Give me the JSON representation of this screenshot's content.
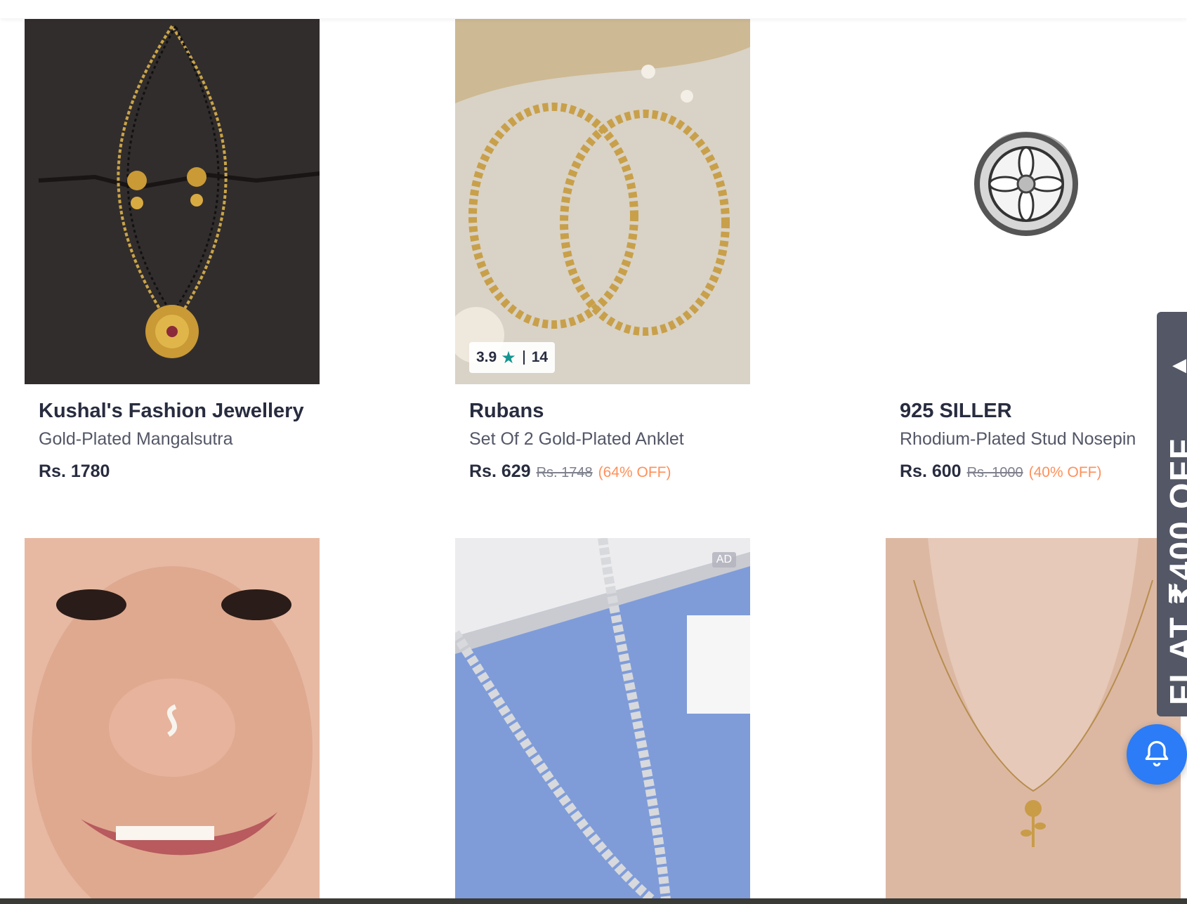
{
  "products": [
    {
      "brand": "Kushal's Fashion Jewellery",
      "name": "Gold-Plated Mangalsutra",
      "price": "Rs. 1780",
      "mrp": "",
      "discount": ""
    },
    {
      "brand": "Rubans",
      "name": "Set Of 2 Gold-Plated Anklet",
      "price": "Rs. 629",
      "mrp": "Rs. 1748",
      "discount": "(64% OFF)",
      "rating": "3.9",
      "rating_count": "14"
    },
    {
      "brand": "925 SILLER",
      "name": "Rhodium-Plated Stud Nosepin",
      "price": "Rs. 600",
      "mrp": "Rs. 1000",
      "discount": "(40% OFF)"
    },
    {
      "image": "nose-ring-photo"
    },
    {
      "image": "silver-chain-photo",
      "badge": "AD"
    },
    {
      "image": "pendant-necklace-photo"
    }
  ],
  "side_banner": {
    "text": "FLAT ₹400 OFF",
    "arrow": "chevron-left-icon"
  },
  "notification": {
    "icon": "bell-icon",
    "color": "#2b7cf6"
  },
  "colors": {
    "discount": "#ff905a",
    "rating_star": "#14958f",
    "side_banner": "#535766"
  }
}
